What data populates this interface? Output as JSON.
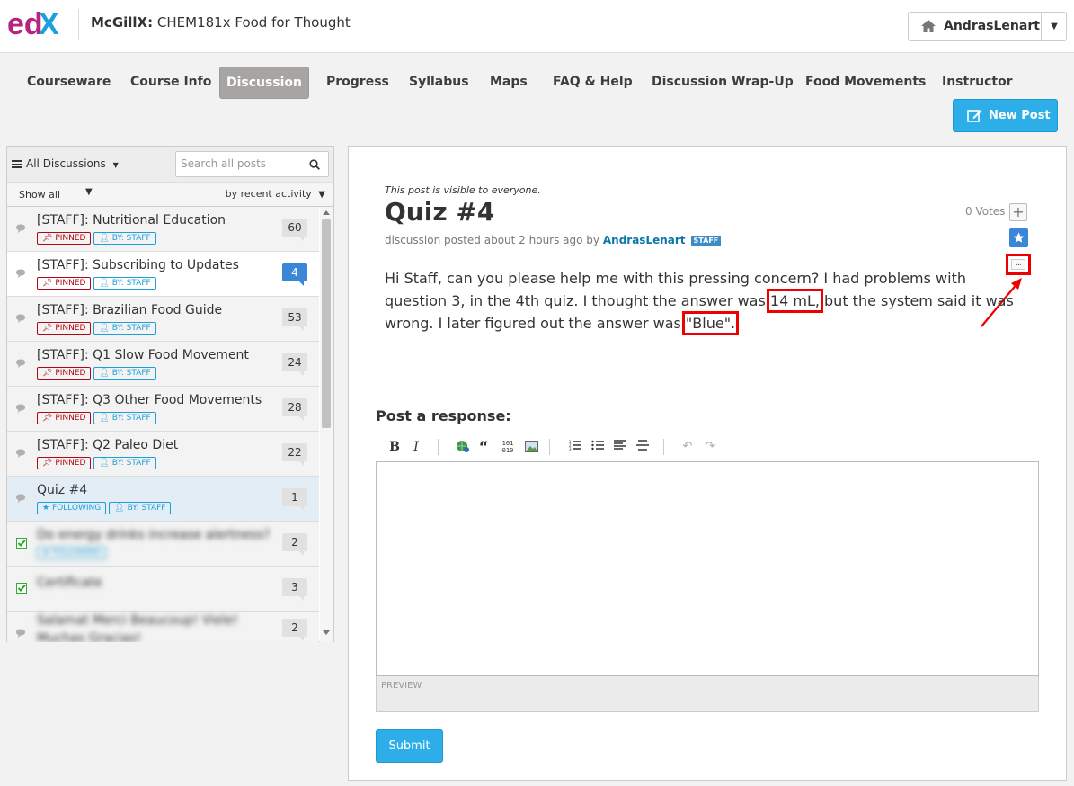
{
  "header": {
    "logo_text": "edX",
    "course_org": "McGillX:",
    "course_name": "CHEM181x Food for Thought",
    "username": "AndrasLenart"
  },
  "tabs": [
    {
      "label": "Courseware"
    },
    {
      "label": "Course Info"
    },
    {
      "label": "Discussion"
    },
    {
      "label": "Progress"
    },
    {
      "label": "Syllabus"
    },
    {
      "label": "Maps"
    },
    {
      "label": "FAQ & Help"
    },
    {
      "label": "Discussion Wrap-Up"
    },
    {
      "label": "Food Movements"
    },
    {
      "label": "Instructor"
    }
  ],
  "new_post_label": "New Post",
  "sidebar": {
    "scope_label": "All Discussions",
    "search_placeholder": "Search all posts",
    "filter_label": "Show all",
    "sort_label": "by recent activity",
    "threads": [
      {
        "title": "[STAFF]: Nutritional Education",
        "tags": [
          "PINNED",
          "BY: STAFF"
        ],
        "count": "60"
      },
      {
        "title": "[STAFF]: Subscribing to Updates",
        "tags": [
          "PINNED",
          "BY: STAFF"
        ],
        "count": "4"
      },
      {
        "title": "[STAFF]: Brazilian Food Guide",
        "tags": [
          "PINNED",
          "BY: STAFF"
        ],
        "count": "53"
      },
      {
        "title": "[STAFF]: Q1 Slow Food Movement",
        "tags": [
          "PINNED",
          "BY: STAFF"
        ],
        "count": "24"
      },
      {
        "title": "[STAFF]: Q3 Other Food Movements",
        "tags": [
          "PINNED",
          "BY: STAFF"
        ],
        "count": "28"
      },
      {
        "title": "[STAFF]: Q2 Paleo Diet",
        "tags": [
          "PINNED",
          "BY: STAFF"
        ],
        "count": "22"
      },
      {
        "title": "Quiz #4",
        "tags": [
          "FOLLOWING",
          "BY: STAFF"
        ],
        "count": "1"
      },
      {
        "title": "Do energy drinks increase alertness?",
        "tags": [
          "FOLLOWING"
        ],
        "count": "2"
      },
      {
        "title": "Certificate",
        "tags": [],
        "count": "3"
      },
      {
        "title": "Salamat Merci Beaucoup! Viele!",
        "title2": "Muchas Gracias!",
        "tags": [],
        "count": "2"
      }
    ]
  },
  "post": {
    "visibility": "This post is visible to everyone.",
    "title": "Quiz #4",
    "meta_prefix": "discussion posted about 2 hours ago by",
    "author": "AndrasLenart",
    "author_badge": "STAFF",
    "votes": "0 Votes",
    "body_1": "Hi Staff, can you please help me with this pressing concern? I had problems with question 3, in the 4th quiz. I thought the answer was ",
    "highlight_1": "14 mL,",
    "body_2": " but the system said it was wrong. I later figured out the answer was ",
    "highlight_2": "\"Blue\".",
    "more_label": "..."
  },
  "response": {
    "label": "Post a response:",
    "preview_label": "PREVIEW",
    "submit_label": "Submit"
  },
  "colors": {
    "accent": "#2eaee8",
    "pinned": "#b20610",
    "staff": "#1d9fd9",
    "highlight_box": "#e00000"
  }
}
